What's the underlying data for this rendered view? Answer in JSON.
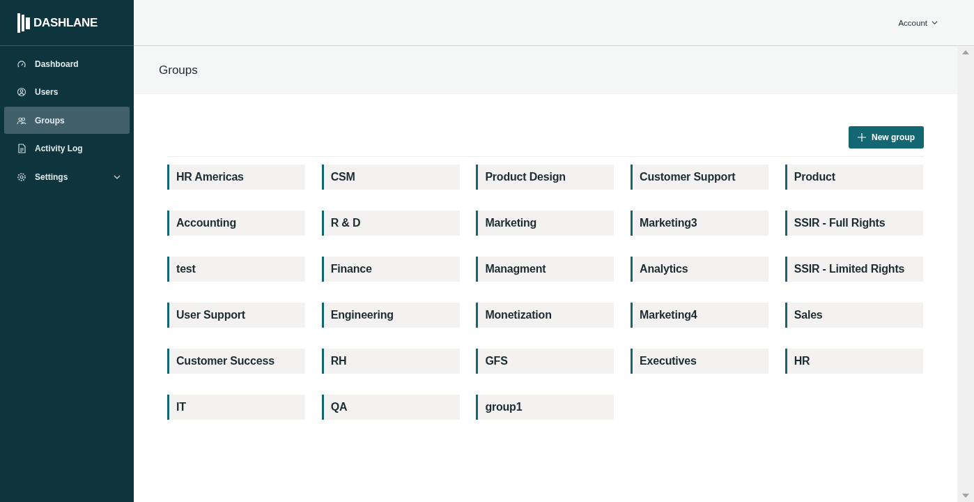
{
  "sidebar": {
    "logo": "DASHLANE",
    "items": [
      {
        "kind": "dashboard",
        "label": "Dashboard",
        "selected": false
      },
      {
        "kind": "users",
        "label": "Users",
        "selected": false
      },
      {
        "kind": "groups",
        "label": "Groups",
        "selected": true
      },
      {
        "kind": "log",
        "label": "Activity Log",
        "selected": false
      },
      {
        "kind": "settings",
        "label": "Settings",
        "selected": false,
        "expanded": false
      }
    ]
  },
  "header": {
    "account": "Account"
  },
  "page": {
    "title": "Groups",
    "new_button": "New group",
    "groups": [
      "HR Americas",
      "CSM",
      "Product Design",
      "Customer Support",
      "Product",
      "Accounting",
      "R & D",
      "Marketing",
      "Marketing3",
      "SSIR - Full Rights",
      "test",
      "Finance",
      "Managment",
      "Analytics",
      "SSIR - Limited Rights",
      "User Support",
      "Engineering",
      "Monetization",
      "Marketing4",
      "Sales",
      "Customer Success",
      "RH",
      "GFS",
      "Executives",
      "HR",
      "IT",
      "QA",
      "group1"
    ]
  }
}
